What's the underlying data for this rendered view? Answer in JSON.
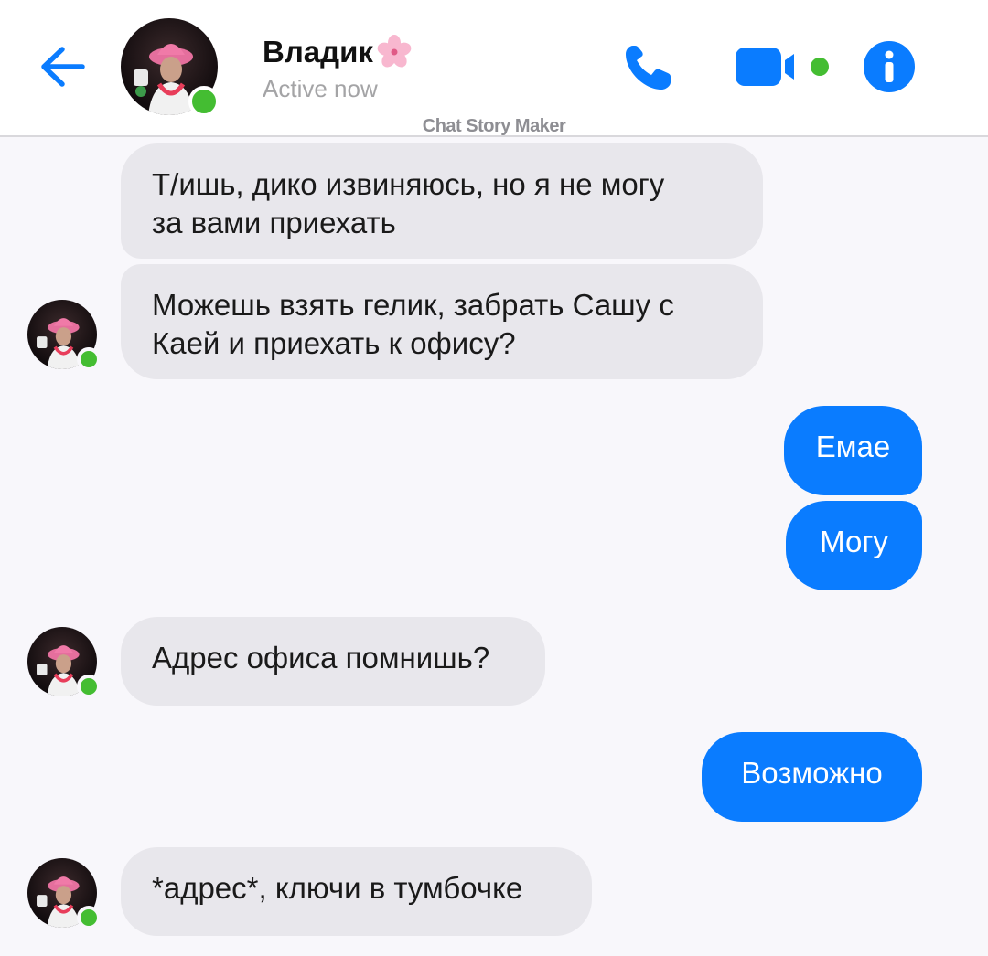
{
  "header": {
    "contact_name": "Владик",
    "status": "Active now",
    "watermark": "Chat Story Maker",
    "back_icon": "arrow-left-icon",
    "call_icon": "phone-icon",
    "video_icon": "video-camera-icon",
    "info_icon": "info-icon"
  },
  "messages": [
    {
      "side": "in",
      "text": "Т/ишь, дико извиняюсь, но я не могу\nза вами приехать",
      "avatar": false
    },
    {
      "side": "in",
      "text": "Можешь взять гелик, забрать Сашу с\nКаей и приехать к офису?",
      "avatar": true
    },
    {
      "side": "out",
      "text": "Емае"
    },
    {
      "side": "out",
      "text": "Могу"
    },
    {
      "side": "in",
      "text": "Адрес офиса помнишь?",
      "avatar": true
    },
    {
      "side": "out",
      "text": "Возможно"
    },
    {
      "side": "in",
      "text": "*адрес*, ключи в тумбочке",
      "avatar": true
    }
  ],
  "colors": {
    "accent": "#0a7cff",
    "online": "#44bd32",
    "incoming_bubble": "#e8e7ec",
    "background": "#f8f7fb"
  }
}
